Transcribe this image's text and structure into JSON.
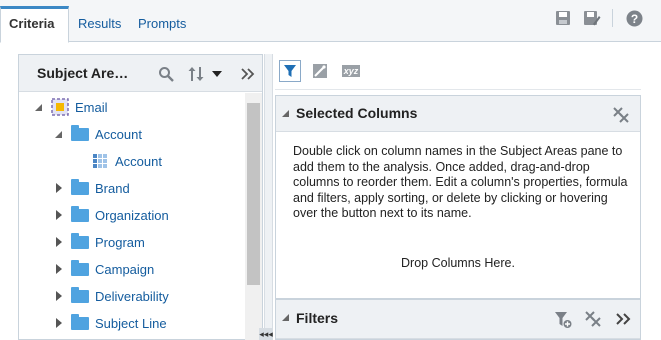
{
  "tabs": [
    {
      "label": "Criteria",
      "active": true
    },
    {
      "label": "Results",
      "active": false
    },
    {
      "label": "Prompts",
      "active": false
    }
  ],
  "top_icons": [
    "save-icon",
    "save-as-icon",
    "help-icon"
  ],
  "subject_areas": {
    "title": "Subject Are…",
    "icons": [
      "search-icon",
      "sort-icon",
      "dropdown-icon",
      "collapse-pane-icon"
    ],
    "tree": [
      {
        "label": "Email",
        "expanded": true,
        "icon": "subject-area-icon"
      },
      {
        "label": "Account",
        "expanded": true,
        "icon": "folder-icon"
      },
      {
        "label": "Account",
        "icon": "table-icon"
      },
      {
        "label": "Brand",
        "expanded": false,
        "icon": "folder-icon"
      },
      {
        "label": "Organization",
        "expanded": false,
        "icon": "folder-icon"
      },
      {
        "label": "Program",
        "expanded": false,
        "icon": "folder-icon"
      },
      {
        "label": "Campaign",
        "expanded": false,
        "icon": "folder-icon"
      },
      {
        "label": "Deliverability",
        "expanded": false,
        "icon": "folder-icon"
      },
      {
        "label": "Subject Line",
        "expanded": false,
        "icon": "folder-icon"
      }
    ]
  },
  "splitter": {
    "label": "◂◂◂"
  },
  "toolbar": {
    "icons": [
      "filter-icon",
      "edit-formula-icon",
      "xyz-icon"
    ],
    "xyz_label": "xyz"
  },
  "selected_columns": {
    "title": "Selected Columns",
    "instructions": "Double click on column names in the Subject Areas pane to add them to the analysis. Once added, drag-and-drop columns to reorder them. Edit a column's properties, formula and filters, apply sorting, or delete by clicking or hovering over the button next to its name.",
    "drop_text": "Drop Columns Here."
  },
  "filters": {
    "title": "Filters"
  },
  "colors": {
    "accent": "#3b88c5",
    "link": "#145c9e",
    "folder": "#4fa3e0",
    "header_bg": "#eef1f4"
  }
}
